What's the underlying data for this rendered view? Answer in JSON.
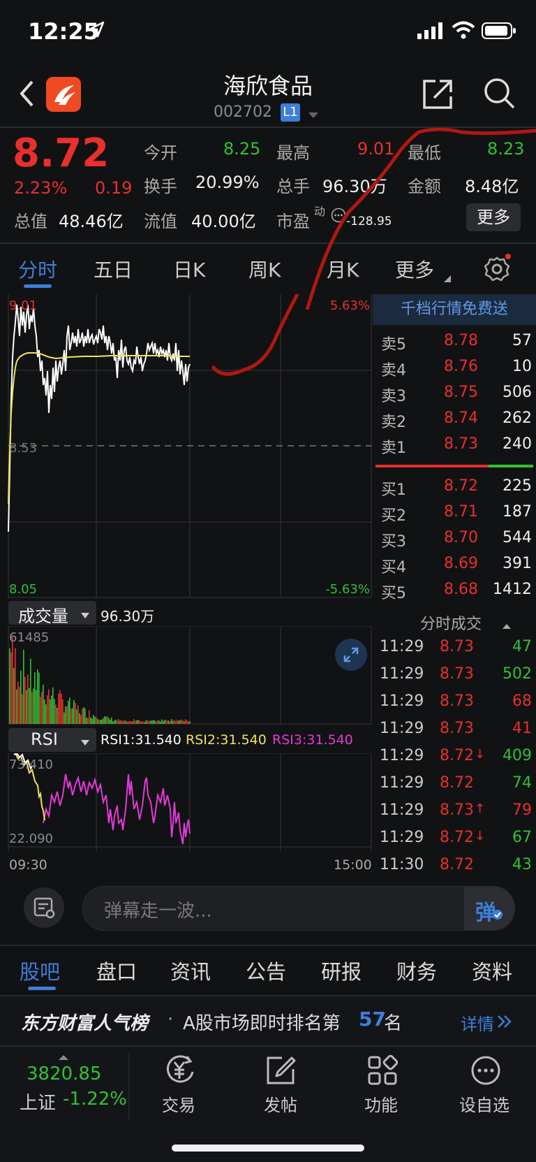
{
  "status_bar": {
    "time": "12:25"
  },
  "header": {
    "title": "海欣食品",
    "code": "002702",
    "level_badge": "L1"
  },
  "quote": {
    "price": "8.72",
    "change_pct": "2.23%",
    "change": "0.19",
    "total_value_label": "总值",
    "total_value": "48.46亿",
    "float_value_label": "流值",
    "float_value": "40.00亿",
    "pe_label": "市盈",
    "pe_sup": "动",
    "pe_value": "-128.95",
    "open_label": "今开",
    "open": "8.25",
    "high_label": "最高",
    "high": "9.01",
    "low_label": "最低",
    "low": "8.23",
    "turnover_label": "换手",
    "turnover": "20.99%",
    "volume_label": "总手",
    "volume": "96.30万",
    "amount_label": "金额",
    "amount": "8.48亿",
    "more_button": "更多"
  },
  "chart_tabs": [
    "分时",
    "五日",
    "日K",
    "周K",
    "月K",
    "更多"
  ],
  "intraday": {
    "y_high": "9.01",
    "y_mid": "8.53",
    "y_low": "8.05",
    "pct_high": "5.63%",
    "pct_low": "-5.63%",
    "volume_label": "成交量",
    "volume_total": "96.30万",
    "volume_max": "61485",
    "rsi_label": "RSI",
    "rsi1": "RSI1:31.540",
    "rsi2": "RSI2:31.540",
    "rsi3": "RSI3:31.540",
    "rsi_high": "73.410",
    "rsi_low": "22.090",
    "time_start": "09:30",
    "time_end": "15:00",
    "colors": {
      "price_line": "#ffffff",
      "avg_line": "#f2e35a",
      "rsi1": "#ffffff",
      "rsi2": "#f2e35a",
      "rsi3": "#e23ad8",
      "up": "#e8302c",
      "down": "#2fc236"
    }
  },
  "order_book": {
    "banner": "千档行情免费送",
    "asks": [
      {
        "label": "卖5",
        "price": "8.78",
        "vol": "57"
      },
      {
        "label": "卖4",
        "price": "8.76",
        "vol": "10"
      },
      {
        "label": "卖3",
        "price": "8.75",
        "vol": "506"
      },
      {
        "label": "卖2",
        "price": "8.74",
        "vol": "262"
      },
      {
        "label": "卖1",
        "price": "8.73",
        "vol": "240"
      }
    ],
    "bids": [
      {
        "label": "买1",
        "price": "8.72",
        "vol": "225"
      },
      {
        "label": "买2",
        "price": "8.71",
        "vol": "187"
      },
      {
        "label": "买3",
        "price": "8.70",
        "vol": "544"
      },
      {
        "label": "买4",
        "price": "8.69",
        "vol": "391"
      },
      {
        "label": "买5",
        "price": "8.68",
        "vol": "1412"
      }
    ],
    "ticks_title": "分时成交",
    "ticks": [
      {
        "time": "11:29",
        "price": "8.73",
        "vol": "47",
        "arrow": "",
        "vol_color": "green"
      },
      {
        "time": "11:29",
        "price": "8.73",
        "vol": "502",
        "arrow": "",
        "vol_color": "green"
      },
      {
        "time": "11:29",
        "price": "8.73",
        "vol": "68",
        "arrow": "",
        "vol_color": "red"
      },
      {
        "time": "11:29",
        "price": "8.73",
        "vol": "41",
        "arrow": "",
        "vol_color": "red"
      },
      {
        "time": "11:29",
        "price": "8.72",
        "vol": "409",
        "arrow": "↓",
        "vol_color": "green"
      },
      {
        "time": "11:29",
        "price": "8.72",
        "vol": "74",
        "arrow": "",
        "vol_color": "green"
      },
      {
        "time": "11:29",
        "price": "8.73",
        "vol": "79",
        "arrow": "↑",
        "vol_color": "red"
      },
      {
        "time": "11:29",
        "price": "8.72",
        "vol": "67",
        "arrow": "↓",
        "vol_color": "green"
      },
      {
        "time": "11:30",
        "price": "8.72",
        "vol": "43",
        "arrow": "",
        "vol_color": "green"
      }
    ]
  },
  "comment_bar": {
    "placeholder": "弹幕走一波...",
    "danmu_button": "弹"
  },
  "section_tabs": [
    "股吧",
    "盘口",
    "资讯",
    "公告",
    "研报",
    "财务",
    "资料"
  ],
  "ranking": {
    "brand": "东方财富人气榜",
    "text_prefix": "A股市场即时排名第",
    "rank": "57",
    "text_suffix": "名",
    "details": "详情"
  },
  "bottom_nav": {
    "index_value": "3820.85",
    "index_name": "上证",
    "index_change": "-1.22%",
    "items": [
      "交易",
      "发帖",
      "功能",
      "设自选"
    ]
  }
}
